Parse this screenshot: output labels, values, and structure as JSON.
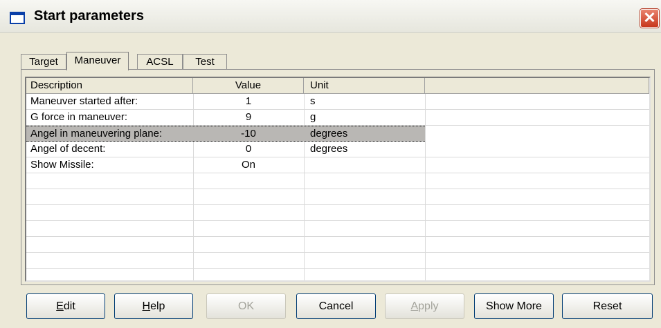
{
  "window": {
    "title": "Start parameters",
    "close_glyph": "✕"
  },
  "tabs": [
    {
      "label": "Target"
    },
    {
      "label": "Maneuver",
      "active": true
    },
    {
      "label": "ACSL"
    },
    {
      "label": "Test"
    }
  ],
  "table": {
    "columns": [
      "Description",
      "Value",
      "Unit",
      ""
    ],
    "rows": [
      {
        "description": "Maneuver started after:",
        "value": "1",
        "unit": "s"
      },
      {
        "description": "G force in maneuver:",
        "value": "9",
        "unit": "g"
      },
      {
        "description": "Angel in maneuvering plane:",
        "value": "-10",
        "unit": "degrees",
        "selected": true
      },
      {
        "description": "Angel of decent:",
        "value": "0",
        "unit": "degrees"
      },
      {
        "description": "Show Missile:",
        "value": "On",
        "unit": ""
      }
    ]
  },
  "buttons": {
    "edit": {
      "label_mn": "E",
      "label_rest": "dit"
    },
    "help": {
      "label_mn": "H",
      "label_rest": "elp"
    },
    "ok": {
      "label": "OK",
      "disabled": true
    },
    "cancel": {
      "label": "Cancel"
    },
    "apply": {
      "label_mn": "A",
      "label_rest": "pply",
      "disabled": true
    },
    "show_more": {
      "label": "Show More"
    },
    "reset": {
      "label": "Reset"
    }
  }
}
